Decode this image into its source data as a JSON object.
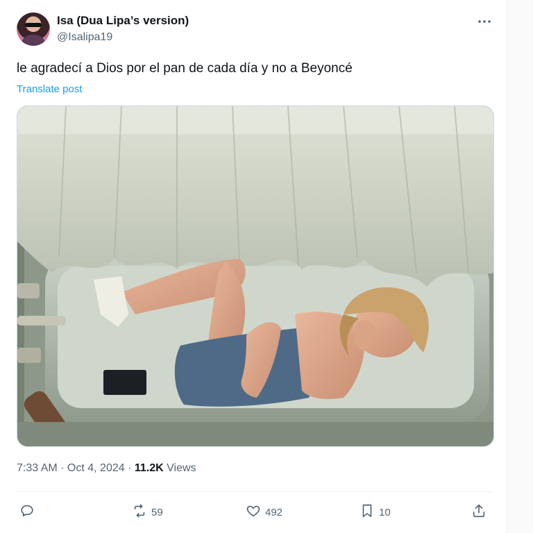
{
  "author": {
    "display_name": "Isa (Dua Lipa’s version)",
    "handle": "@Isalipa19"
  },
  "post": {
    "text": "le agradecí a Dios por el pan de cada día y no a Beyoncé",
    "translate_label": "Translate post",
    "time": "7:33 AM",
    "separator": " · ",
    "date": "Oct 4, 2024",
    "views_count": "11.2K",
    "views_label": "Views"
  },
  "actions": {
    "reply_count": "",
    "retweet_count": "59",
    "like_count": "492",
    "bookmark_count": "10"
  },
  "icons": [
    "more-icon",
    "reply-icon",
    "retweet-icon",
    "like-icon",
    "bookmark-icon",
    "share-icon"
  ],
  "colors": {
    "link": "#1d9bf0",
    "muted": "#536471",
    "text": "#0f1419"
  }
}
